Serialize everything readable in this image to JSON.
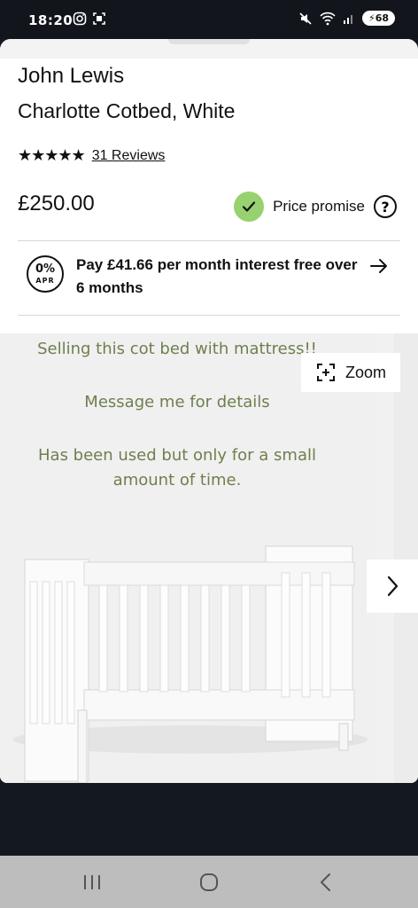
{
  "status": {
    "time": "18:20",
    "battery": "68",
    "left_icons": [
      "instagram-icon",
      "screenshot-icon"
    ],
    "right_icons": [
      "mute-icon",
      "wifi-icon",
      "signal-icon",
      "battery-icon"
    ]
  },
  "product": {
    "brand": "John Lewis",
    "name": "Charlotte Cotbed, White",
    "stars": "★★★★★",
    "reviews": "31 Reviews",
    "price": "£250.00",
    "price_promise": "Price promise",
    "help": "?"
  },
  "finance": {
    "badge_main": "0%",
    "badge_sub": "APR",
    "text": "Pay £41.66 per month interest free over 6 months"
  },
  "gallery": {
    "overlay_line1": "Selling this cot bed with mattress!!",
    "overlay_line2": "Message me for details",
    "overlay_line3": "Has been used but only for a small amount of time.",
    "zoom": "Zoom"
  },
  "colors": {
    "accent_green": "#98d16f",
    "overlay_text": "#6f7f4d",
    "background": "#141821"
  }
}
